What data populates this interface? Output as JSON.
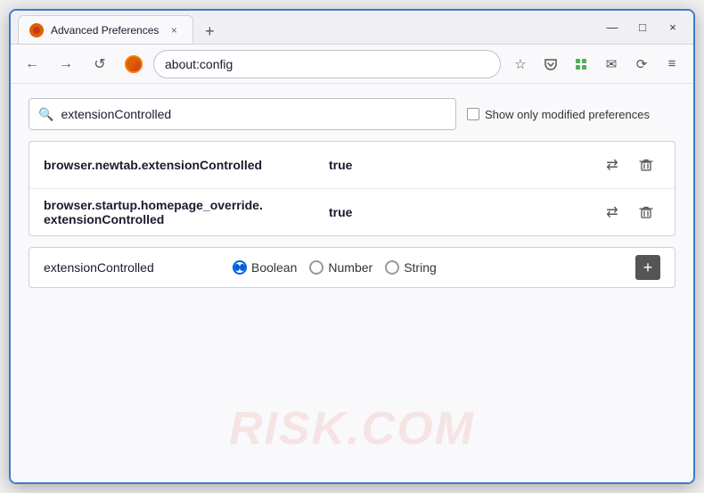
{
  "window": {
    "title": "Advanced Preferences",
    "tab_label": "Advanced Preferences",
    "close_label": "×",
    "minimize_label": "—",
    "maximize_label": "□",
    "new_tab_label": "+"
  },
  "navbar": {
    "back_label": "←",
    "forward_label": "→",
    "reload_label": "↺",
    "browser_name": "Firefox",
    "address": "about:config",
    "bookmark_icon": "☆",
    "pocket_icon": "⛉",
    "extension_icon": "⬛",
    "mail_icon": "✉",
    "account_icon": "⟳",
    "menu_icon": "≡"
  },
  "search": {
    "placeholder": "extensionControlled",
    "value": "extensionControlled",
    "show_modified_label": "Show only modified preferences"
  },
  "results": [
    {
      "name": "browser.newtab.extensionControlled",
      "value": "true",
      "toggle_label": "⇄",
      "delete_label": "🗑"
    },
    {
      "name": "browser.startup.homepage_override.\nextensionControlled",
      "name_line1": "browser.startup.homepage_override.",
      "name_line2": "extensionControlled",
      "value": "true",
      "toggle_label": "⇄",
      "delete_label": "🗑"
    }
  ],
  "add_pref": {
    "name": "extensionControlled",
    "types": [
      {
        "label": "Boolean",
        "selected": true
      },
      {
        "label": "Number",
        "selected": false
      },
      {
        "label": "String",
        "selected": false
      }
    ],
    "add_label": "+"
  },
  "watermark": "RISK.COM"
}
